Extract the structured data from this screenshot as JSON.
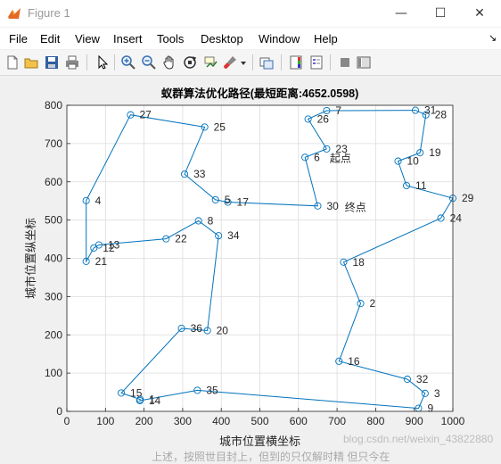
{
  "window": {
    "title": "Figure 1",
    "minimize_glyph": "—",
    "maximize_glyph": "☐",
    "close_glyph": "✕"
  },
  "menu": {
    "items": [
      "File",
      "Edit",
      "View",
      "Insert",
      "Tools",
      "Desktop",
      "Window",
      "Help"
    ],
    "dock_arrow": "↘"
  },
  "toolbar": {
    "icons": [
      "new-figure-icon",
      "open-file-icon",
      "save-icon",
      "print-icon",
      "pointer-icon",
      "zoom-in-icon",
      "zoom-out-icon",
      "pan-icon",
      "rotate-3d-icon",
      "data-cursor-icon",
      "brush-icon",
      "brush-dropdown-icon",
      "link-plot-icon",
      "insert-colorbar-icon",
      "insert-legend-icon",
      "hide-plot-tools-icon",
      "show-plot-tools-icon"
    ]
  },
  "colors": {
    "line": "#0072BD",
    "axes_bg": "#ffffff",
    "figure_bg": "#f0f0f0"
  },
  "chart_data": {
    "type": "line",
    "title": "蚁群算法优化路径(最短距离:4652.0598)",
    "xlabel": "城市位置横坐标",
    "ylabel": "城市位置纵坐标",
    "xlim": [
      0,
      1000
    ],
    "ylim": [
      0,
      800
    ],
    "xticks": [
      0,
      100,
      200,
      300,
      400,
      500,
      600,
      700,
      800,
      900,
      1000
    ],
    "yticks": [
      0,
      100,
      200,
      300,
      400,
      500,
      600,
      700,
      800
    ],
    "grid": true,
    "marker": "circle",
    "route": [
      {
        "id": 23,
        "x": 673,
        "y": 686
      },
      {
        "id": 26,
        "x": 625,
        "y": 764
      },
      {
        "id": 7,
        "x": 673,
        "y": 786
      },
      {
        "id": 31,
        "x": 903,
        "y": 787
      },
      {
        "id": 28,
        "x": 930,
        "y": 775
      },
      {
        "id": 19,
        "x": 915,
        "y": 676
      },
      {
        "id": 10,
        "x": 858,
        "y": 654
      },
      {
        "id": 11,
        "x": 880,
        "y": 590
      },
      {
        "id": 29,
        "x": 1000,
        "y": 557
      },
      {
        "id": 24,
        "x": 969,
        "y": 505
      },
      {
        "id": 18,
        "x": 717,
        "y": 390
      },
      {
        "id": 2,
        "x": 761,
        "y": 282
      },
      {
        "id": 16,
        "x": 705,
        "y": 131
      },
      {
        "id": 32,
        "x": 882,
        "y": 84
      },
      {
        "id": 3,
        "x": 928,
        "y": 47
      },
      {
        "id": 9,
        "x": 911,
        "y": 8
      },
      {
        "id": 35,
        "x": 338,
        "y": 55
      },
      {
        "id": 14,
        "x": 189,
        "y": 28
      },
      {
        "id": 1,
        "x": 190,
        "y": 31
      },
      {
        "id": 15,
        "x": 141,
        "y": 48
      },
      {
        "id": 36,
        "x": 297,
        "y": 217
      },
      {
        "id": 20,
        "x": 364,
        "y": 211
      },
      {
        "id": 34,
        "x": 393,
        "y": 459
      },
      {
        "id": 8,
        "x": 341,
        "y": 498
      },
      {
        "id": 22,
        "x": 257,
        "y": 451
      },
      {
        "id": 13,
        "x": 83,
        "y": 435
      },
      {
        "id": 12,
        "x": 70,
        "y": 427
      },
      {
        "id": 21,
        "x": 50,
        "y": 392
      },
      {
        "id": 4,
        "x": 50,
        "y": 551
      },
      {
        "id": 27,
        "x": 165,
        "y": 775
      },
      {
        "id": 25,
        "x": 357,
        "y": 743
      },
      {
        "id": 33,
        "x": 305,
        "y": 620
      },
      {
        "id": 5,
        "x": 385,
        "y": 553
      },
      {
        "id": 17,
        "x": 417,
        "y": 547
      },
      {
        "id": 30,
        "x": 650,
        "y": 537
      },
      {
        "id": 6,
        "x": 617,
        "y": 664
      },
      {
        "id": 23,
        "x": 673,
        "y": 686
      }
    ],
    "annotations": [
      {
        "text": "起点",
        "x": 681,
        "y": 661
      },
      {
        "text": "终点",
        "x": 720,
        "y": 533
      }
    ]
  },
  "watermark": "blog.csdn.net/weixin_43822880",
  "overlay_text": "上述，按照世目封上，但到的只仅解时精 但只今在"
}
